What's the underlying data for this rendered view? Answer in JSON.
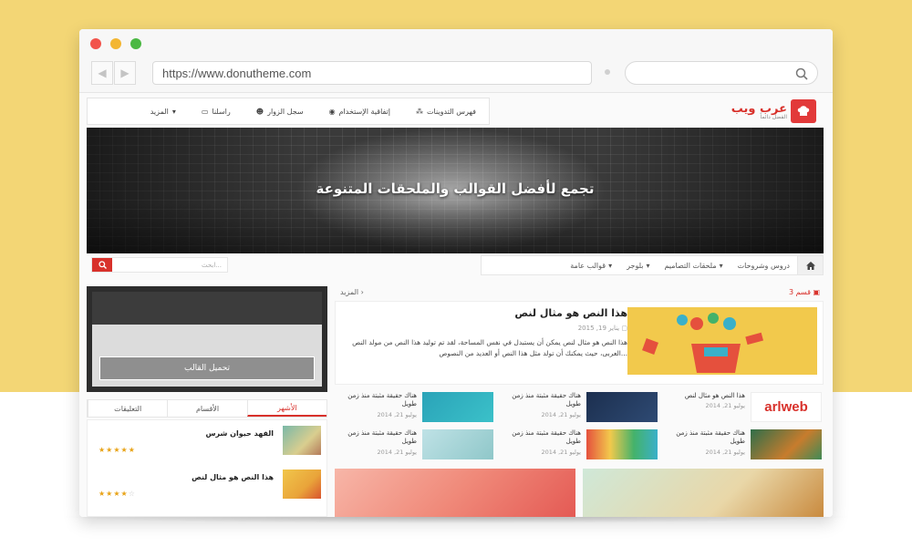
{
  "browser": {
    "url": "https://www.donutheme.com",
    "dots": [
      "#f2544c",
      "#f3b632",
      "#4bb843"
    ]
  },
  "site": {
    "logo_text": "عرب ويب",
    "logo_sub": "الفضل دائماً",
    "top_nav": [
      {
        "label": "فهرس التدوينات",
        "icon": "sitemap-icon"
      },
      {
        "label": "إتفاقية الإستخدام",
        "icon": "eye-icon"
      },
      {
        "label": "سجل الزوار",
        "icon": "users-icon"
      },
      {
        "label": "راسلنا",
        "icon": "envelope-icon"
      },
      {
        "label": "المزيد",
        "icon": "caret-down-icon"
      }
    ],
    "banner_title": "تجمع لأفضل القوالب والملحقات المتنوعة",
    "cat_nav": [
      {
        "label": "دروس وشروحات"
      },
      {
        "label": "ملحقات التصاميم"
      },
      {
        "label": "بلوجر"
      },
      {
        "label": "قوالب عامة"
      }
    ],
    "search_placeholder": "ابحث..."
  },
  "main": {
    "section_name": "قسم 3",
    "more_label": "المزيد",
    "featured": {
      "title": "هذا النص هو مثال لنص",
      "date": "يناير 19, 2015",
      "excerpt": "هذا النص هو مثال لنص يمكن أن يستبدل في نفس المساحة، لقد تم توليد هذا النص من مولد النص العربى، حيث يمكنك أن تولد مثل هذا النص أو العديد من النصوص..."
    },
    "grid": [
      {
        "title": "هذا النص هو مثال لنص",
        "date": "يوليو 21, 2014",
        "thumb": "arlweb"
      },
      {
        "title": "هناك حقيقة مثبتة منذ زمن طويل",
        "date": "يوليو 21, 2014",
        "thumb": "rocket"
      },
      {
        "title": "هناك حقيقة مثبتة منذ زمن طويل",
        "date": "يوليو 21, 2014",
        "thumb": "bird"
      },
      {
        "title": "هناك حقيقة مثبتة منذ زمن طويل",
        "date": "يوليو 21, 2014",
        "thumb": "jungle"
      },
      {
        "title": "هناك حقيقة مثبتة منذ زمن طويل",
        "date": "يوليو 21, 2014",
        "thumb": "colors"
      },
      {
        "title": "هناك حقيقة مثبتة منذ زمن طويل",
        "date": "يوليو 21, 2014",
        "thumb": "yellowbird"
      }
    ]
  },
  "sidebar": {
    "download_label": "تحميل القالب",
    "tabs": [
      "الأشهر",
      "الأقسام",
      "التعليقات"
    ],
    "popular": [
      {
        "title": "الفهد حيوان شرس",
        "rating": 5
      },
      {
        "title": "هذا النص هو مثال لنص",
        "rating": 4
      }
    ]
  },
  "colors": {
    "accent": "#d8312b",
    "page_bg": "#f3d675"
  }
}
